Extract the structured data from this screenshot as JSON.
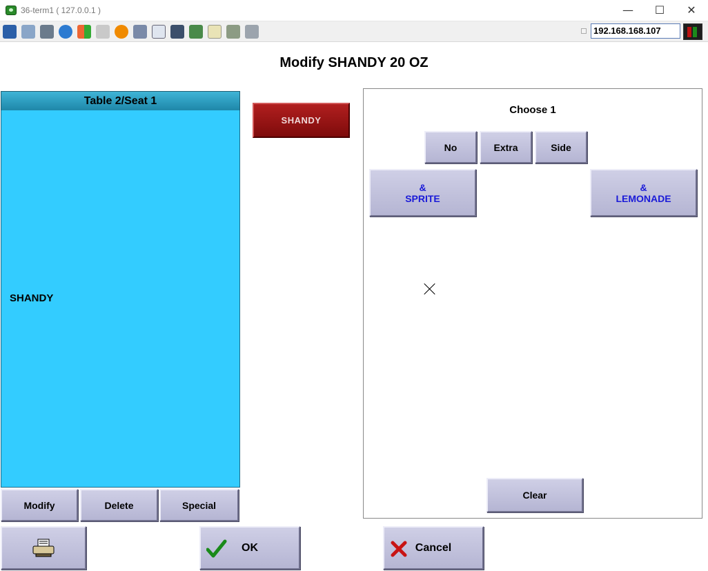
{
  "window": {
    "title": "36-term1 ( 127.0.0.1 )",
    "minimize": "—",
    "maximize": "☐",
    "close": "✕"
  },
  "toolbar": {
    "ip_address": "192.168.168.107",
    "icons": [
      "monitor-icon",
      "windows-icon",
      "tools-icon",
      "refresh-icon",
      "windows-logo-icon",
      "keyboard-icon",
      "alert-icon",
      "network-icon",
      "fullscreen-icon",
      "display-icon",
      "download-icon",
      "notepad-icon",
      "screen-icon",
      "chat-icon"
    ]
  },
  "page": {
    "title": "Modify SHANDY 20 OZ"
  },
  "seat": {
    "header": "Table 2/Seat 1",
    "items": [
      "SHANDY"
    ]
  },
  "item_button": "SHANDY",
  "modifiers": {
    "choose_label": "Choose 1",
    "qualifiers": [
      "No",
      "Extra",
      "Side"
    ],
    "options": [
      {
        "line1": "&",
        "line2": "SPRITE"
      },
      {
        "line1": "&",
        "line2": "LEMONADE"
      }
    ],
    "clear": "Clear"
  },
  "seat_actions": {
    "modify": "Modify",
    "delete": "Delete",
    "special": "Special"
  },
  "footer": {
    "ok": "OK",
    "cancel": "Cancel"
  }
}
